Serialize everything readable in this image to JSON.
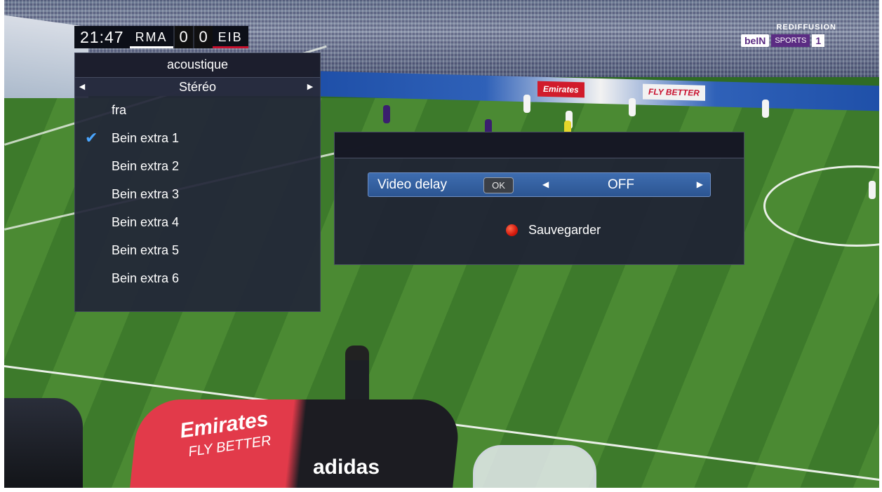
{
  "scorebug": {
    "time": "21:47",
    "home_team": "RMA",
    "home_score": "0",
    "away_score": "0",
    "away_team": "EIB"
  },
  "channel_logo": {
    "tag": "REDIFFUSION",
    "brand": "beIN",
    "network": "SPORTS",
    "number": "1"
  },
  "background_ads": {
    "board1": "Emirates",
    "board2": "FLY BETTER",
    "bench_text1": "Emirates",
    "bench_text2": "FLY BETTER",
    "bench_brand": "adidas"
  },
  "audio_menu": {
    "title": "acoustique",
    "mode_selector": {
      "value": "Stéréo",
      "left_arrow_icon": "left-arrow-icon",
      "right_arrow_icon": "right-arrow-icon"
    },
    "tracks": [
      {
        "label": "fra",
        "selected": false
      },
      {
        "label": "Bein extra 1",
        "selected": true
      },
      {
        "label": "Bein extra 2",
        "selected": false
      },
      {
        "label": "Bein extra 3",
        "selected": false
      },
      {
        "label": "Bein extra 4",
        "selected": false
      },
      {
        "label": "Bein extra 5",
        "selected": false
      },
      {
        "label": "Bein extra 6",
        "selected": false
      }
    ],
    "check_mark": "✔"
  },
  "video_delay_dialog": {
    "label": "Video delay",
    "ok_badge": "OK",
    "value": "OFF",
    "save_label": "Sauvegarder",
    "save_key_color": "#d4180c"
  },
  "colors": {
    "panel_bg": "#222638",
    "highlight_row": "#3e6db0",
    "check_accent": "#4aa6ff"
  }
}
